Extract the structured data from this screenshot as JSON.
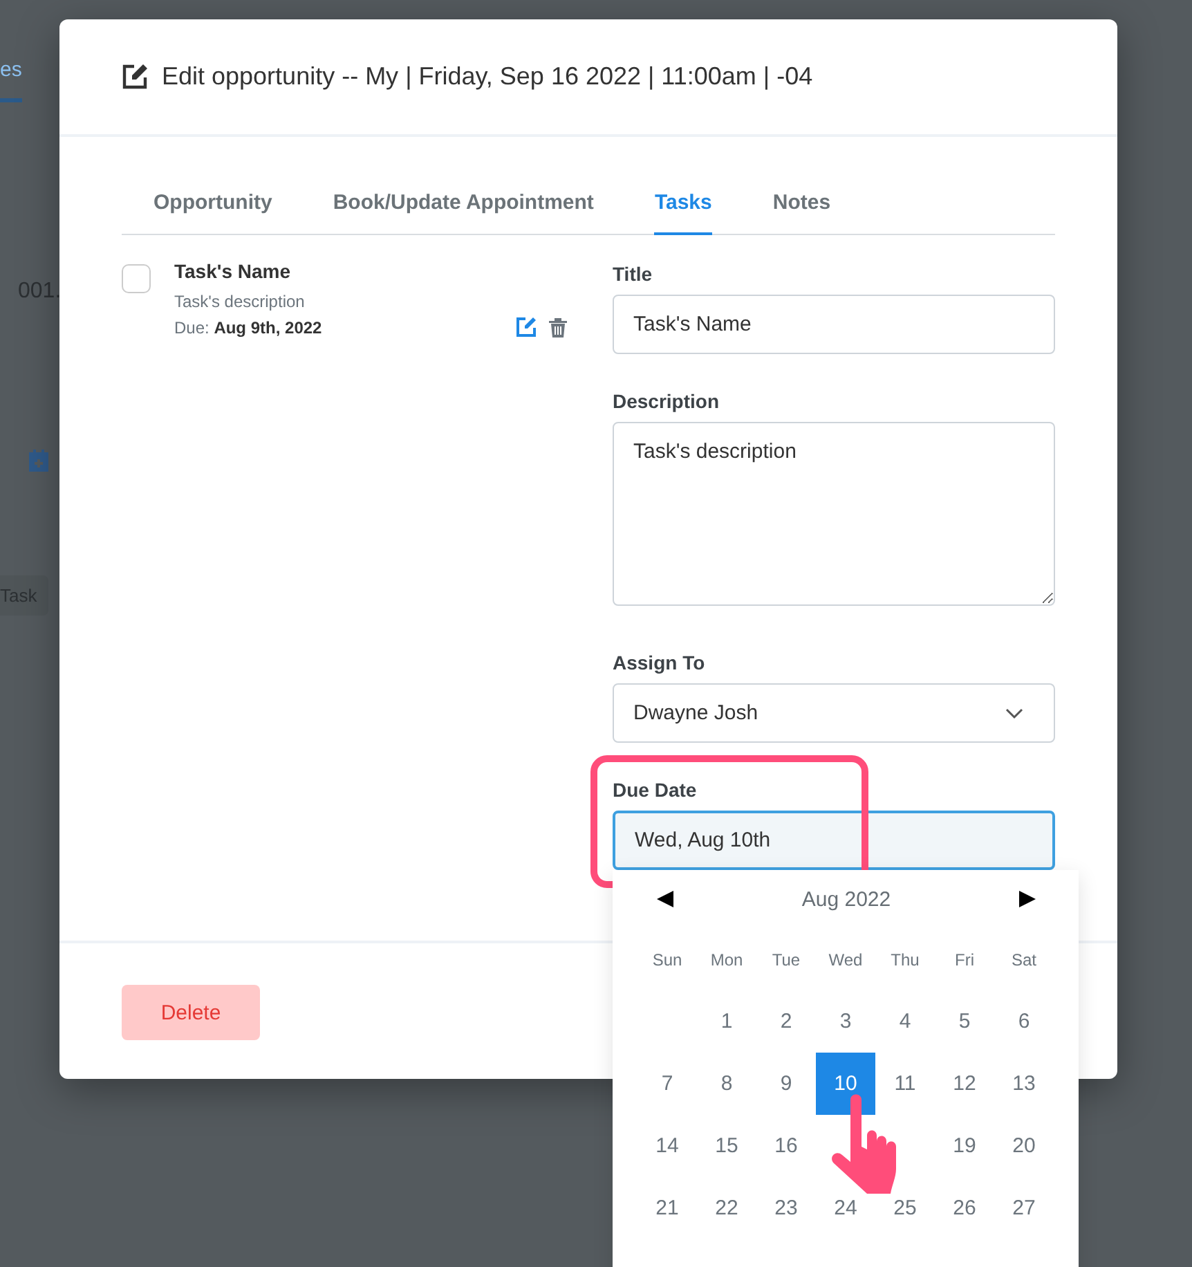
{
  "background_page": {
    "tab": "es",
    "cell": "001.",
    "button": "Task"
  },
  "dialog": {
    "title": "Edit opportunity -- My | Friday, Sep 16 2022 | 11:00am | -04",
    "tabs": [
      {
        "label": "Opportunity",
        "selected": false
      },
      {
        "label": "Book/Update Appointment",
        "selected": false
      },
      {
        "label": "Tasks",
        "selected": true
      },
      {
        "label": "Notes",
        "selected": false
      }
    ],
    "tasks": [
      {
        "name": "Task's Name",
        "description": "Task's description",
        "due": "Due: **Aug 9th, 2022**",
        "checked": false
      }
    ],
    "form": {
      "title": {
        "label": "Title",
        "value": "Task's Name"
      },
      "description": {
        "label": "Description",
        "value": "Task's description"
      },
      "assign_to": {
        "label": "Assign To",
        "value": "Dwayne Josh"
      },
      "due_date": {
        "label": "Due Date",
        "value": "Wed, Aug 10th",
        "focused": true,
        "highlighted": true
      }
    },
    "delete_button": "Delete"
  },
  "datepicker": {
    "month": "Aug 2022",
    "weekdays": [
      "Sun",
      "Mon",
      "Tue",
      "Wed",
      "Thu",
      "Fri",
      "Sat"
    ],
    "weeks": [
      [
        {
          "kind": "blank"
        },
        {
          "kind": "day",
          "day": "1",
          "selected": false
        },
        {
          "kind": "day",
          "day": "2",
          "selected": false
        },
        {
          "kind": "day",
          "day": "3",
          "selected": false
        },
        {
          "kind": "day",
          "day": "4",
          "selected": false
        },
        {
          "kind": "day",
          "day": "5",
          "selected": false
        },
        {
          "kind": "day",
          "day": "6",
          "selected": false
        }
      ],
      [
        {
          "kind": "day",
          "day": "7",
          "selected": false
        },
        {
          "kind": "day",
          "day": "8",
          "selected": false
        },
        {
          "kind": "day",
          "day": "9",
          "selected": false
        },
        {
          "kind": "day",
          "day": "10",
          "selected": true
        },
        {
          "kind": "day",
          "day": "11",
          "selected": false
        },
        {
          "kind": "day",
          "day": "12",
          "selected": false
        },
        {
          "kind": "day",
          "day": "13",
          "selected": false
        }
      ],
      [
        {
          "kind": "day",
          "day": "14",
          "selected": false
        },
        {
          "kind": "day",
          "day": "15",
          "selected": false
        },
        {
          "kind": "day",
          "day": "16",
          "selected": false
        },
        {
          "kind": "blank"
        },
        {
          "kind": "blank"
        },
        {
          "kind": "day",
          "day": "19",
          "selected": false
        },
        {
          "kind": "day",
          "day": "20",
          "selected": false
        }
      ],
      [
        {
          "kind": "day",
          "day": "21",
          "selected": false
        },
        {
          "kind": "day",
          "day": "22",
          "selected": false
        },
        {
          "kind": "day",
          "day": "23",
          "selected": false
        },
        {
          "kind": "day",
          "day": "24",
          "selected": false
        },
        {
          "kind": "day",
          "day": "25",
          "selected": false
        },
        {
          "kind": "day",
          "day": "26",
          "selected": false
        },
        {
          "kind": "day",
          "day": "27",
          "selected": false
        }
      ]
    ],
    "pointer": true
  }
}
